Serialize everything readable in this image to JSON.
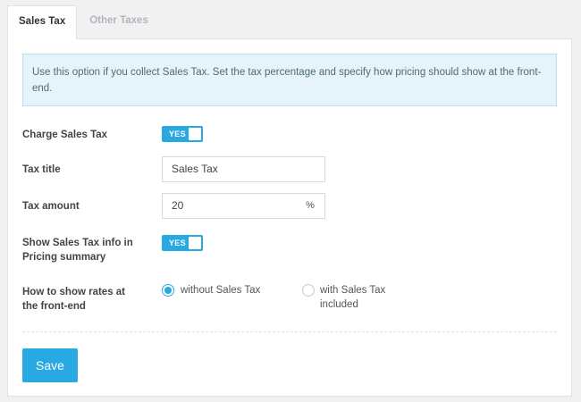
{
  "tabs": [
    {
      "label": "Sales Tax",
      "active": true
    },
    {
      "label": "Other Taxes",
      "active": false
    }
  ],
  "notice": {
    "text": "Use this option if you collect Sales Tax. Set the tax percentage and specify how pricing should show at the front-end."
  },
  "form": {
    "charge_sales_tax": {
      "label": "Charge Sales Tax",
      "toggle_text": "YES",
      "value": true
    },
    "tax_title": {
      "label": "Tax title",
      "value": "Sales Tax"
    },
    "tax_amount": {
      "label": "Tax amount",
      "value": "20",
      "unit": "%"
    },
    "show_info": {
      "label_line1": "Show Sales Tax info in",
      "label_line2": "Pricing summary",
      "toggle_text": "YES",
      "value": true
    },
    "show_rates": {
      "label_line1": "How to show rates at",
      "label_line2": "the front-end",
      "options": [
        {
          "label": "without Sales Tax",
          "checked": true
        },
        {
          "label_line1": "with Sales Tax",
          "label_line2": "included",
          "checked": false
        }
      ]
    }
  },
  "save_button": {
    "label": "Save"
  },
  "colors": {
    "accent": "#29a9e1",
    "notice_bg": "#e5f4fa"
  }
}
